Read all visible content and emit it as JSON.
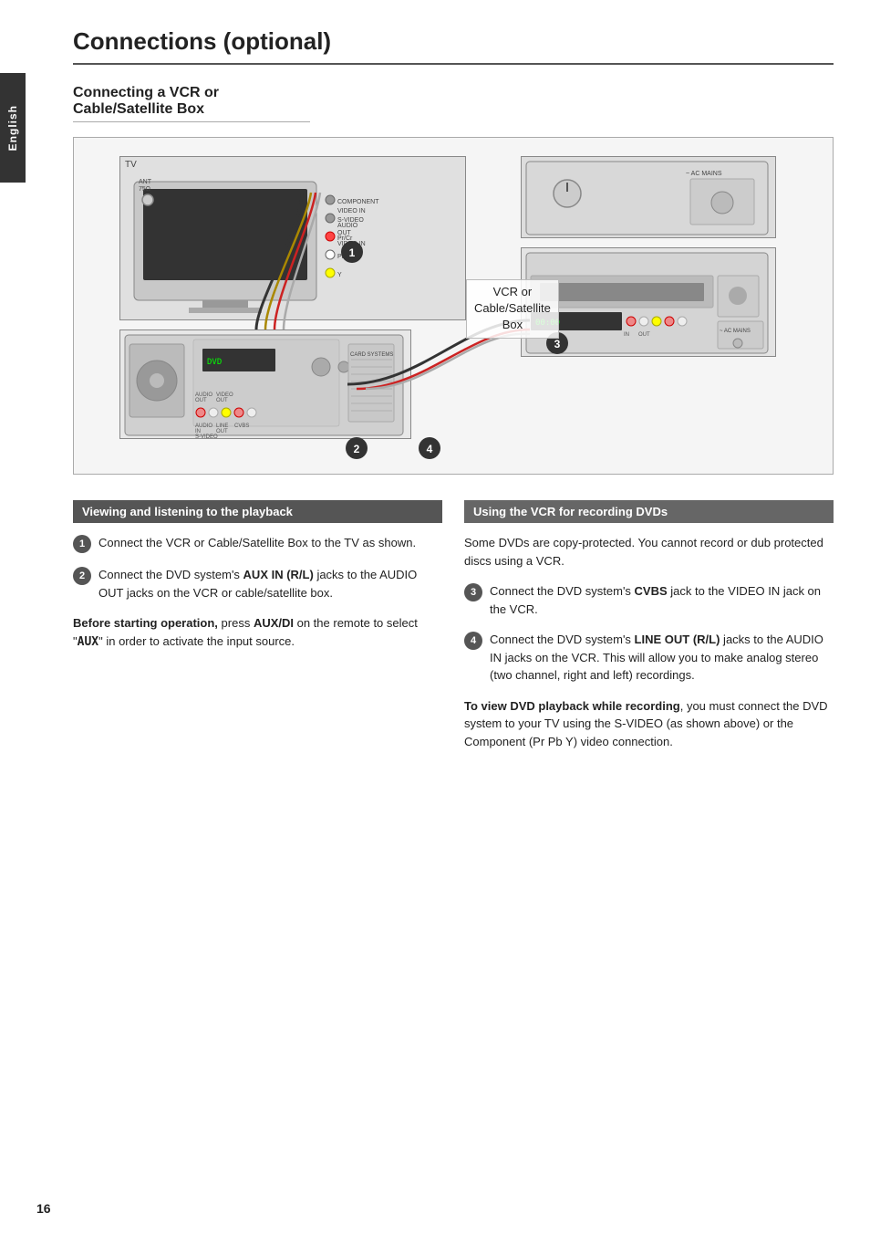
{
  "page": {
    "title": "Connections (optional)",
    "page_number": "16",
    "side_tab": "English"
  },
  "section": {
    "subtitle": "Connecting a VCR or\nCable/Satellite Box"
  },
  "diagram": {
    "vcr_label_line1": "VCR or",
    "vcr_label_line2": "Cable/Satellite",
    "vcr_label_line3": "Box"
  },
  "left_column": {
    "header": "Viewing and listening to the playback",
    "step1": {
      "num": "1",
      "text": "Connect the VCR or Cable/Satellite Box to the TV as shown."
    },
    "step2": {
      "num": "2",
      "text_before": "Connect the DVD system's ",
      "bold": "AUX IN (R/L)",
      "text_after": " jacks to the AUDIO OUT jacks on the VCR or cable/satellite box."
    },
    "note": {
      "bold_start": "Before starting operation,",
      "text": " press ",
      "bold_btn": "AUX/DI",
      "text2": " on the remote to select \"",
      "mono": "AUX",
      "text3": "\" in order to activate the input source."
    }
  },
  "right_column": {
    "header": "Using the VCR for recording DVDs",
    "copy_note": "Some DVDs are copy-protected. You cannot record or dub protected discs using a VCR.",
    "step3": {
      "num": "3",
      "text_before": "Connect the DVD system's ",
      "bold": "CVBS",
      "text_after": " jack to the VIDEO IN jack on the VCR."
    },
    "step4": {
      "num": "4",
      "text_before": "Connect the DVD system's ",
      "bold": "LINE OUT (R/L)",
      "text_after": " jacks to the AUDIO IN jacks on the VCR. This will allow you to make analog stereo (two channel, right and left) recordings."
    },
    "view_note": {
      "bold": "To view DVD playback while recording",
      "text": ", you must connect the DVD system to your TV using the S-VIDEO (as shown above) or the Component (Pr Pb Y) video connection."
    }
  }
}
